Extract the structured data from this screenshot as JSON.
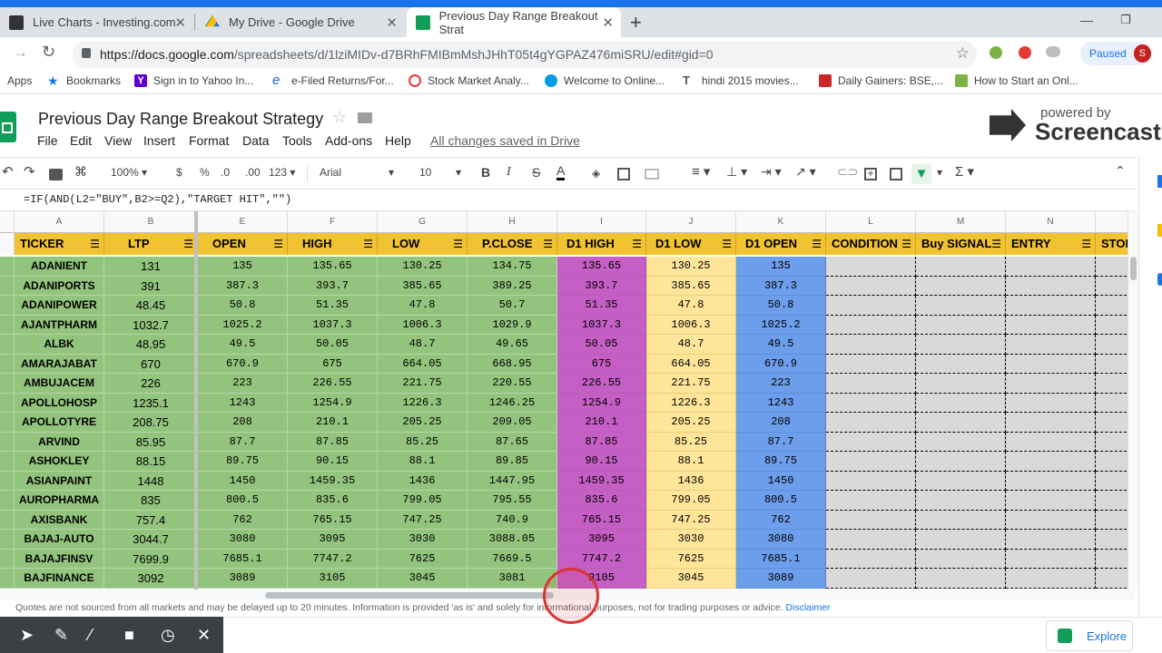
{
  "browser": {
    "tabs": [
      {
        "title": "Live Charts - Investing.com",
        "icon_color": "#333333"
      },
      {
        "title": "My Drive - Google Drive",
        "icon_color": "#fbbc04"
      },
      {
        "title": "Previous Day Range Breakout Strat",
        "icon_color": "#0f9d58"
      }
    ],
    "url_host": "https://docs.google.com",
    "url_path": "/spreadsheets/d/1lziMIDv-d7BRhFMIBmMshJHhT05t4gYGPAZ476miSRU/edit#gid=0",
    "profile_label": "Paused",
    "profile_initial": "S"
  },
  "bookmarks": [
    {
      "label": "Apps",
      "icon": "apps-icon",
      "color": "#5f6368"
    },
    {
      "label": "Bookmarks",
      "icon": "star-icon",
      "color": "#1a73e8"
    },
    {
      "label": "Sign in to Yahoo In...",
      "icon": "yahoo-icon",
      "color": "#5f01d1"
    },
    {
      "label": "e-Filed Returns/For...",
      "icon": "ie-icon",
      "color": "#1565c0"
    },
    {
      "label": "Stock Market Analy...",
      "icon": "gauge-icon",
      "color": "#e53935"
    },
    {
      "label": "Welcome to Online...",
      "icon": "globe-icon",
      "color": "#039be5"
    },
    {
      "label": "hindi 2015 movies...",
      "icon": "tz-icon",
      "color": "#455a64"
    },
    {
      "label": "Daily Gainers: BSE,...",
      "icon": "daily-gainers-icon",
      "color": "#c62828"
    },
    {
      "label": "How to Start an Onl...",
      "icon": "how-to-icon",
      "color": "#7cb342"
    }
  ],
  "sheet": {
    "title": "Previous Day Range Breakout Strategy",
    "menus": [
      "File",
      "Edit",
      "View",
      "Insert",
      "Format",
      "Data",
      "Tools",
      "Add-ons",
      "Help"
    ],
    "saved_status": "All changes saved in Drive"
  },
  "toolbar": {
    "zoom": "100%",
    "currency": "$",
    "percent": "%",
    "decimal_less": ".0",
    "decimal_more": ".00",
    "more_formats": "123",
    "font": "Arial",
    "font_size": "10",
    "bold": "B",
    "italic": "I",
    "strike": "S",
    "text_color": "A"
  },
  "formula": "=IF(AND(L2=\"BUY\",B2>=Q2),\"TARGET HIT\",\"\")",
  "columns": [
    "A",
    "B",
    "E",
    "F",
    "G",
    "H",
    "I",
    "J",
    "K",
    "L",
    "M",
    "N"
  ],
  "headers": [
    "TICKER",
    "LTP",
    "OPEN",
    "HIGH",
    "LOW",
    "P.CLOSE",
    "D1 HIGH",
    "D1 LOW",
    "D1 OPEN",
    "CONDITION",
    "Buy SIGNAL",
    "ENTRY",
    "STOP"
  ],
  "rows": [
    [
      "ADANIENT",
      "131",
      "135",
      "135.65",
      "130.25",
      "134.75",
      "135.65",
      "130.25",
      "135"
    ],
    [
      "ADANIPORTS",
      "391",
      "387.3",
      "393.7",
      "385.65",
      "389.25",
      "393.7",
      "385.65",
      "387.3"
    ],
    [
      "ADANIPOWER",
      "48.45",
      "50.8",
      "51.35",
      "47.8",
      "50.7",
      "51.35",
      "47.8",
      "50.8"
    ],
    [
      "AJANTPHARM",
      "1032.7",
      "1025.2",
      "1037.3",
      "1006.3",
      "1029.9",
      "1037.3",
      "1006.3",
      "1025.2"
    ],
    [
      "ALBK",
      "48.95",
      "49.5",
      "50.05",
      "48.7",
      "49.65",
      "50.05",
      "48.7",
      "49.5"
    ],
    [
      "AMARAJABAT",
      "670",
      "670.9",
      "675",
      "664.05",
      "668.95",
      "675",
      "664.05",
      "670.9"
    ],
    [
      "AMBUJACEM",
      "226",
      "223",
      "226.55",
      "221.75",
      "220.55",
      "226.55",
      "221.75",
      "223"
    ],
    [
      "APOLLOHOSP",
      "1235.1",
      "1243",
      "1254.9",
      "1226.3",
      "1246.25",
      "1254.9",
      "1226.3",
      "1243"
    ],
    [
      "APOLLOTYRE",
      "208.75",
      "208",
      "210.1",
      "205.25",
      "209.05",
      "210.1",
      "205.25",
      "208"
    ],
    [
      "ARVIND",
      "85.95",
      "87.7",
      "87.85",
      "85.25",
      "87.65",
      "87.85",
      "85.25",
      "87.7"
    ],
    [
      "ASHOKLEY",
      "88.15",
      "89.75",
      "90.15",
      "88.1",
      "89.85",
      "90.15",
      "88.1",
      "89.75"
    ],
    [
      "ASIANPAINT",
      "1448",
      "1450",
      "1459.35",
      "1436",
      "1447.95",
      "1459.35",
      "1436",
      "1450"
    ],
    [
      "AUROPHARMA",
      "835",
      "800.5",
      "835.6",
      "799.05",
      "795.55",
      "835.6",
      "799.05",
      "800.5"
    ],
    [
      "AXISBANK",
      "757.4",
      "762",
      "765.15",
      "747.25",
      "740.9",
      "765.15",
      "747.25",
      "762"
    ],
    [
      "BAJAJ-AUTO",
      "3044.7",
      "3080",
      "3095",
      "3030",
      "3088.05",
      "3095",
      "3030",
      "3080"
    ],
    [
      "BAJAJFINSV",
      "7699.9",
      "7685.1",
      "7747.2",
      "7625",
      "7669.5",
      "7747.2",
      "7625",
      "7685.1"
    ],
    [
      "BAJFINANCE",
      "3092",
      "3089",
      "3105",
      "3045",
      "3081",
      "3105",
      "3045",
      "3089"
    ]
  ],
  "disclaimer": "Quotes are not sourced from all markets and may be delayed up to 20 minutes. Information is provided 'as is' and solely for informational purposes, not for trading purposes or advice.",
  "disclaimer_link": "Disclaimer",
  "explore_label": "Explore",
  "watermark": {
    "line1": "powered by",
    "line2": "Screencastify"
  },
  "colors": {
    "header_yellow": "#f1c232",
    "green": "#93c47d",
    "purple": "#c65fc5",
    "light_yellow": "#ffe599",
    "blue": "#6d9eeb",
    "gray": "#d9d9d9",
    "sheets_green": "#0f9d58"
  }
}
